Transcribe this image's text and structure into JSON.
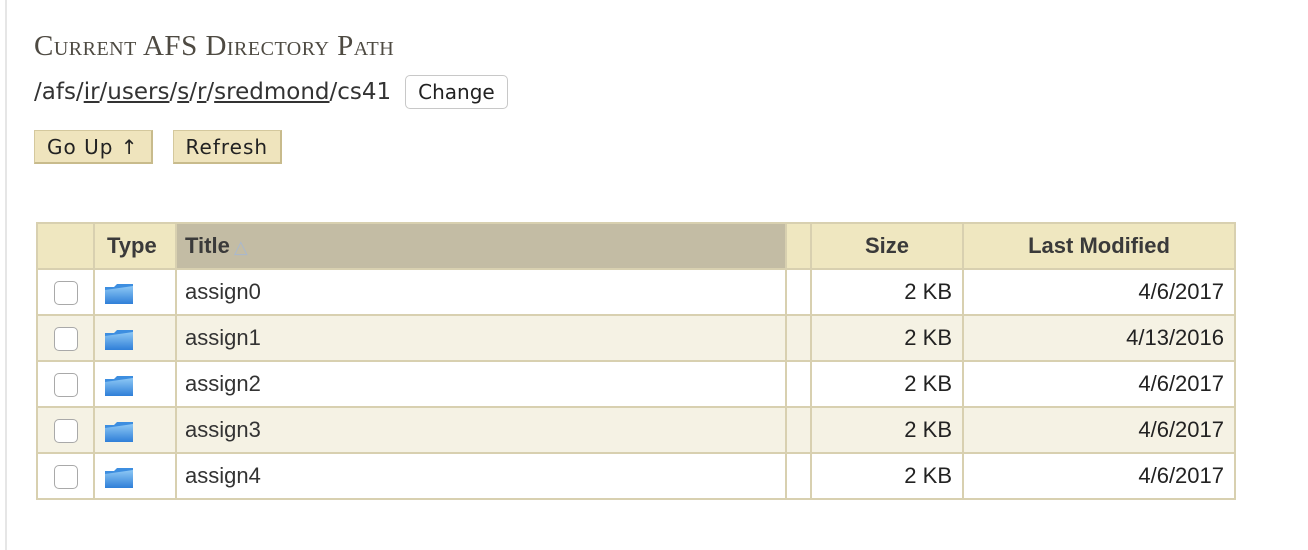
{
  "heading": "Current AFS Directory Path",
  "path": {
    "prefix": "/afs/",
    "segments": [
      "ir",
      "users",
      "s",
      "r",
      "sredmond"
    ],
    "separator": "/",
    "current": "cs41"
  },
  "change_button": "Change",
  "toolbar": {
    "go_up_label": "Go Up ↑",
    "refresh_label": "Refresh"
  },
  "table": {
    "headers": {
      "type": "Type",
      "title": "Title",
      "size": "Size",
      "last_modified": "Last Modified"
    },
    "sort_indicator": "△",
    "rows": [
      {
        "title": "assign0",
        "size": "2 KB",
        "modified": "4/6/2017",
        "icon": "folder-icon"
      },
      {
        "title": "assign1",
        "size": "2 KB",
        "modified": "4/13/2016",
        "icon": "folder-icon"
      },
      {
        "title": "assign2",
        "size": "2 KB",
        "modified": "4/6/2017",
        "icon": "folder-icon"
      },
      {
        "title": "assign3",
        "size": "2 KB",
        "modified": "4/6/2017",
        "icon": "folder-icon"
      },
      {
        "title": "assign4",
        "size": "2 KB",
        "modified": "4/6/2017",
        "icon": "folder-icon"
      }
    ]
  },
  "colors": {
    "header_bg": "#efe7c0",
    "sorted_header_bg": "#c3bca4",
    "button_bg": "#efe4bd",
    "row_alt_bg": "#f5f2e4"
  }
}
